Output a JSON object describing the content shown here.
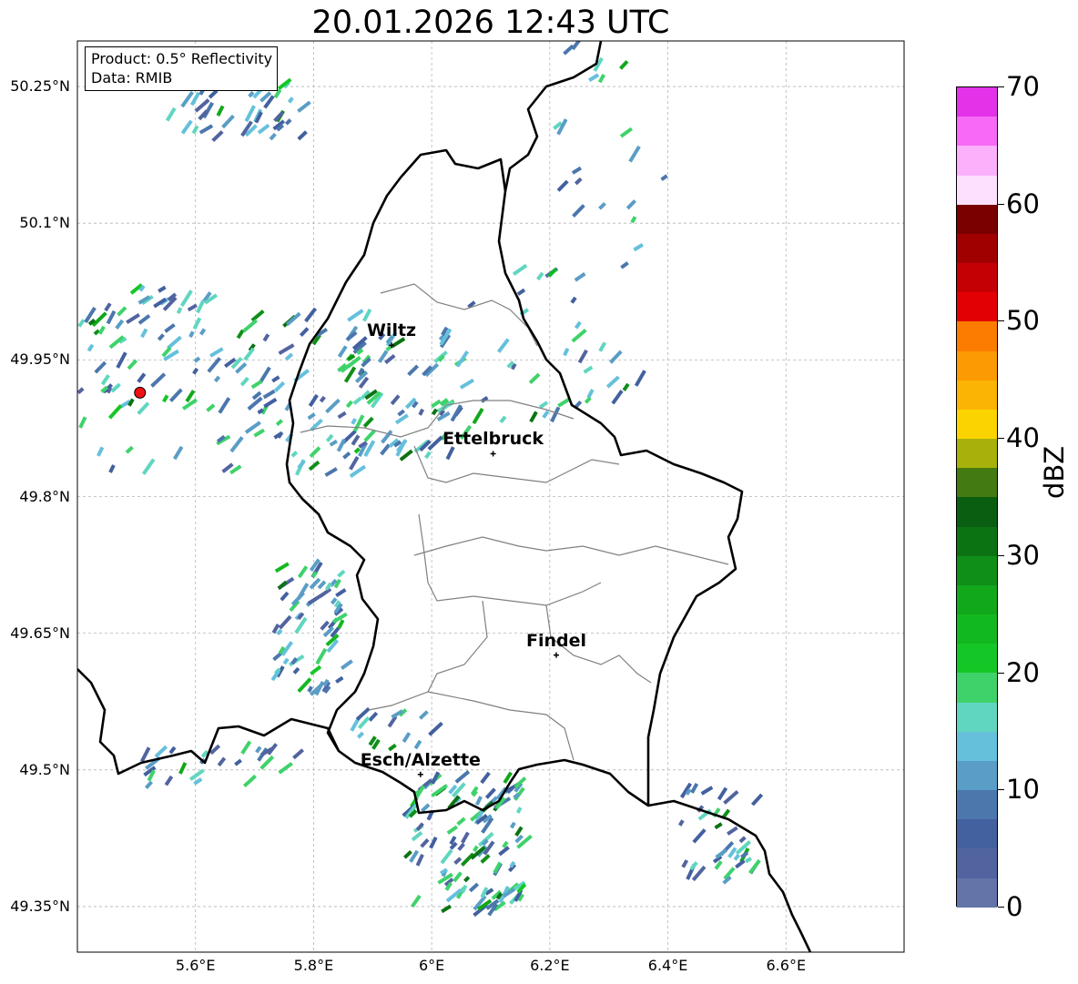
{
  "title": "20.01.2026 12:43 UTC",
  "info": {
    "product": "Product: 0.5° Reflectivity",
    "data": "Data: RMIB"
  },
  "map": {
    "lon_range": [
      5.4,
      6.8
    ],
    "lat_range": [
      49.3,
      50.3
    ],
    "lat_ticks": [
      {
        "value": 50.25,
        "label": "50.25°N"
      },
      {
        "value": 50.1,
        "label": "50.1°N"
      },
      {
        "value": 49.95,
        "label": "49.95°N"
      },
      {
        "value": 49.8,
        "label": "49.8°N"
      },
      {
        "value": 49.65,
        "label": "49.65°N"
      },
      {
        "value": 49.5,
        "label": "49.5°N"
      },
      {
        "value": 49.35,
        "label": "49.35°N"
      }
    ],
    "lon_ticks": [
      {
        "value": 5.6,
        "label": "5.6°E"
      },
      {
        "value": 5.8,
        "label": "5.8°E"
      },
      {
        "value": 6.0,
        "label": "6°E"
      },
      {
        "value": 6.2,
        "label": "6.2°E"
      },
      {
        "value": 6.4,
        "label": "6.4°E"
      },
      {
        "value": 6.6,
        "label": "6.6°E"
      }
    ],
    "radar_site": {
      "lon": 5.506,
      "lat": 49.914
    },
    "cities": [
      {
        "name": "Wiltz",
        "lon": 5.932,
        "lat": 49.966
      },
      {
        "name": "Ettelbruck",
        "lon": 6.104,
        "lat": 49.847
      },
      {
        "name": "Findel",
        "lon": 6.211,
        "lat": 49.626
      },
      {
        "name": "Esch/Alzette",
        "lon": 5.981,
        "lat": 49.495
      }
    ]
  },
  "colorbar": {
    "label": "dBZ",
    "min": 0,
    "max": 70,
    "ticks": [
      {
        "value": 0,
        "label": "0"
      },
      {
        "value": 10,
        "label": "10"
      },
      {
        "value": 20,
        "label": "20"
      },
      {
        "value": 30,
        "label": "30"
      },
      {
        "value": 40,
        "label": "40"
      },
      {
        "value": 50,
        "label": "50"
      },
      {
        "value": 60,
        "label": "60"
      },
      {
        "value": 70,
        "label": "70"
      }
    ],
    "colors": [
      "#6473a8",
      "#5264a0",
      "#43609f",
      "#4b77ad",
      "#5a9dc6",
      "#65c0dc",
      "#60d6c0",
      "#3fd26b",
      "#15c726",
      "#12b81f",
      "#11a81b",
      "#0f8f18",
      "#0c7313",
      "#0a5e11",
      "#447a12",
      "#a8b10b",
      "#fbd400",
      "#fbb404",
      "#fb9a02",
      "#fb7c00",
      "#e30004",
      "#c40005",
      "#a00000",
      "#7a0000",
      "#fde0fd",
      "#fbb0fb",
      "#f769f6",
      "#e332e8"
    ]
  },
  "echo_regions": [
    {
      "lon": [
        5.55,
        5.78
      ],
      "lat": [
        50.19,
        50.26
      ],
      "n": 45
    },
    {
      "lon": [
        5.4,
        5.62
      ],
      "lat": [
        49.98,
        50.03
      ],
      "n": 25
    },
    {
      "lon": [
        5.4,
        5.9
      ],
      "lat": [
        49.82,
        50.0
      ],
      "n": 120
    },
    {
      "lon": [
        5.85,
        6.05
      ],
      "lat": [
        49.84,
        49.98
      ],
      "n": 70
    },
    {
      "lon": [
        6.05,
        6.25
      ],
      "lat": [
        49.88,
        50.05
      ],
      "n": 25
    },
    {
      "lon": [
        5.73,
        5.85
      ],
      "lat": [
        49.58,
        49.72
      ],
      "n": 60
    },
    {
      "lon": [
        5.5,
        5.78
      ],
      "lat": [
        49.48,
        49.52
      ],
      "n": 25
    },
    {
      "lon": [
        5.95,
        6.15
      ],
      "lat": [
        49.34,
        49.49
      ],
      "n": 110
    },
    {
      "lon": [
        5.85,
        6.0
      ],
      "lat": [
        49.52,
        49.56
      ],
      "n": 15
    },
    {
      "lon": [
        6.42,
        6.55
      ],
      "lat": [
        49.36,
        49.48
      ],
      "n": 35
    },
    {
      "lon": [
        6.2,
        6.4
      ],
      "lat": [
        50.05,
        50.3
      ],
      "n": 20
    },
    {
      "lon": [
        6.25,
        6.35
      ],
      "lat": [
        49.9,
        49.97
      ],
      "n": 10
    }
  ]
}
